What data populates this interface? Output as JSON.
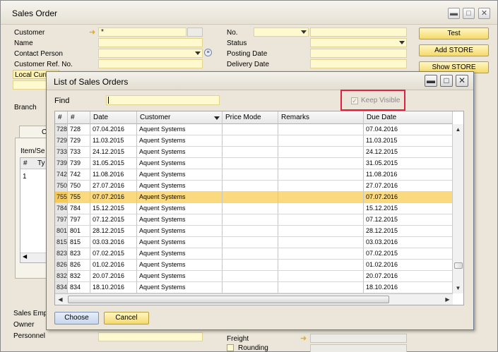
{
  "sales_order": {
    "title": "Sales Order",
    "labels": {
      "customer": "Customer",
      "name": "Name",
      "contact_person": "Contact Person",
      "customer_ref": "Customer Ref. No.",
      "local_currency": "Local Curr",
      "branch": "Branch",
      "no": "No.",
      "status": "Status",
      "posting_date": "Posting Date",
      "delivery_date": "Delivery Date",
      "item_service": "Item/Se",
      "hash": "#",
      "type": "Ty",
      "row_one": "1",
      "tab_partial": "C",
      "sales_employee": "Sales Emp",
      "owner": "Owner",
      "personnel": "Personnel",
      "freight": "Freight",
      "rounding": "Rounding"
    },
    "customer_value": "*",
    "buttons": {
      "test": "Test",
      "add_store": "Add STORE",
      "show_store": "Show STORE"
    }
  },
  "dialog": {
    "title": "List of Sales Orders",
    "find_label": "Find",
    "find_value": "",
    "keep_visible_label": "Keep Visible",
    "keep_visible_checked": true,
    "columns": [
      "#",
      "#",
      "Date",
      "Customer",
      "Price Mode",
      "Remarks",
      "Due Date"
    ],
    "rows": [
      {
        "rownum": "728",
        "doc": "728",
        "date": "07.04.2016",
        "customer": "Aquent Systems",
        "price_mode": "",
        "remarks": "",
        "due": "07.04.2016"
      },
      {
        "rownum": "729",
        "doc": "729",
        "date": "11.03.2015",
        "customer": "Aquent Systems",
        "price_mode": "",
        "remarks": "",
        "due": "11.03.2015"
      },
      {
        "rownum": "733",
        "doc": "733",
        "date": "24.12.2015",
        "customer": "Aquent Systems",
        "price_mode": "",
        "remarks": "",
        "due": "24.12.2015"
      },
      {
        "rownum": "739",
        "doc": "739",
        "date": "31.05.2015",
        "customer": "Aquent Systems",
        "price_mode": "",
        "remarks": "",
        "due": "31.05.2015"
      },
      {
        "rownum": "742",
        "doc": "742",
        "date": "11.08.2016",
        "customer": "Aquent Systems",
        "price_mode": "",
        "remarks": "",
        "due": "11.08.2016"
      },
      {
        "rownum": "750",
        "doc": "750",
        "date": "27.07.2016",
        "customer": "Aquent Systems",
        "price_mode": "",
        "remarks": "",
        "due": "27.07.2016"
      },
      {
        "rownum": "755",
        "doc": "755",
        "date": "07.07.2016",
        "customer": "Aquent Systems",
        "price_mode": "",
        "remarks": "",
        "due": "07.07.2016",
        "selected": true
      },
      {
        "rownum": "784",
        "doc": "784",
        "date": "15.12.2015",
        "customer": "Aquent Systems",
        "price_mode": "",
        "remarks": "",
        "due": "15.12.2015"
      },
      {
        "rownum": "797",
        "doc": "797",
        "date": "07.12.2015",
        "customer": "Aquent Systems",
        "price_mode": "",
        "remarks": "",
        "due": "07.12.2015"
      },
      {
        "rownum": "801",
        "doc": "801",
        "date": "28.12.2015",
        "customer": "Aquent Systems",
        "price_mode": "",
        "remarks": "",
        "due": "28.12.2015"
      },
      {
        "rownum": "815",
        "doc": "815",
        "date": "03.03.2016",
        "customer": "Aquent Systems",
        "price_mode": "",
        "remarks": "",
        "due": "03.03.2016"
      },
      {
        "rownum": "823",
        "doc": "823",
        "date": "07.02.2015",
        "customer": "Aquent Systems",
        "price_mode": "",
        "remarks": "",
        "due": "07.02.2015"
      },
      {
        "rownum": "826",
        "doc": "826",
        "date": "01.02.2016",
        "customer": "Aquent Systems",
        "price_mode": "",
        "remarks": "",
        "due": "01.02.2016"
      },
      {
        "rownum": "832",
        "doc": "832",
        "date": "20.07.2016",
        "customer": "Aquent Systems",
        "price_mode": "",
        "remarks": "",
        "due": "20.07.2016"
      },
      {
        "rownum": "834",
        "doc": "834",
        "date": "18.10.2016",
        "customer": "Aquent Systems",
        "price_mode": "",
        "remarks": "",
        "due": "18.10.2016"
      }
    ],
    "buttons": {
      "choose": "Choose",
      "cancel": "Cancel"
    }
  },
  "colors": {
    "field_yellow": "#fff9cf",
    "selected_row": "#fbd97f",
    "button_gold": "#f5d96b",
    "highlight_red": "#e0203c"
  },
  "icons": {
    "minimize": "minimize-icon",
    "maximize": "maximize-icon",
    "close": "close-icon",
    "link_arrow": "link-arrow-icon",
    "expand_corner": "expand-corner-icon"
  }
}
